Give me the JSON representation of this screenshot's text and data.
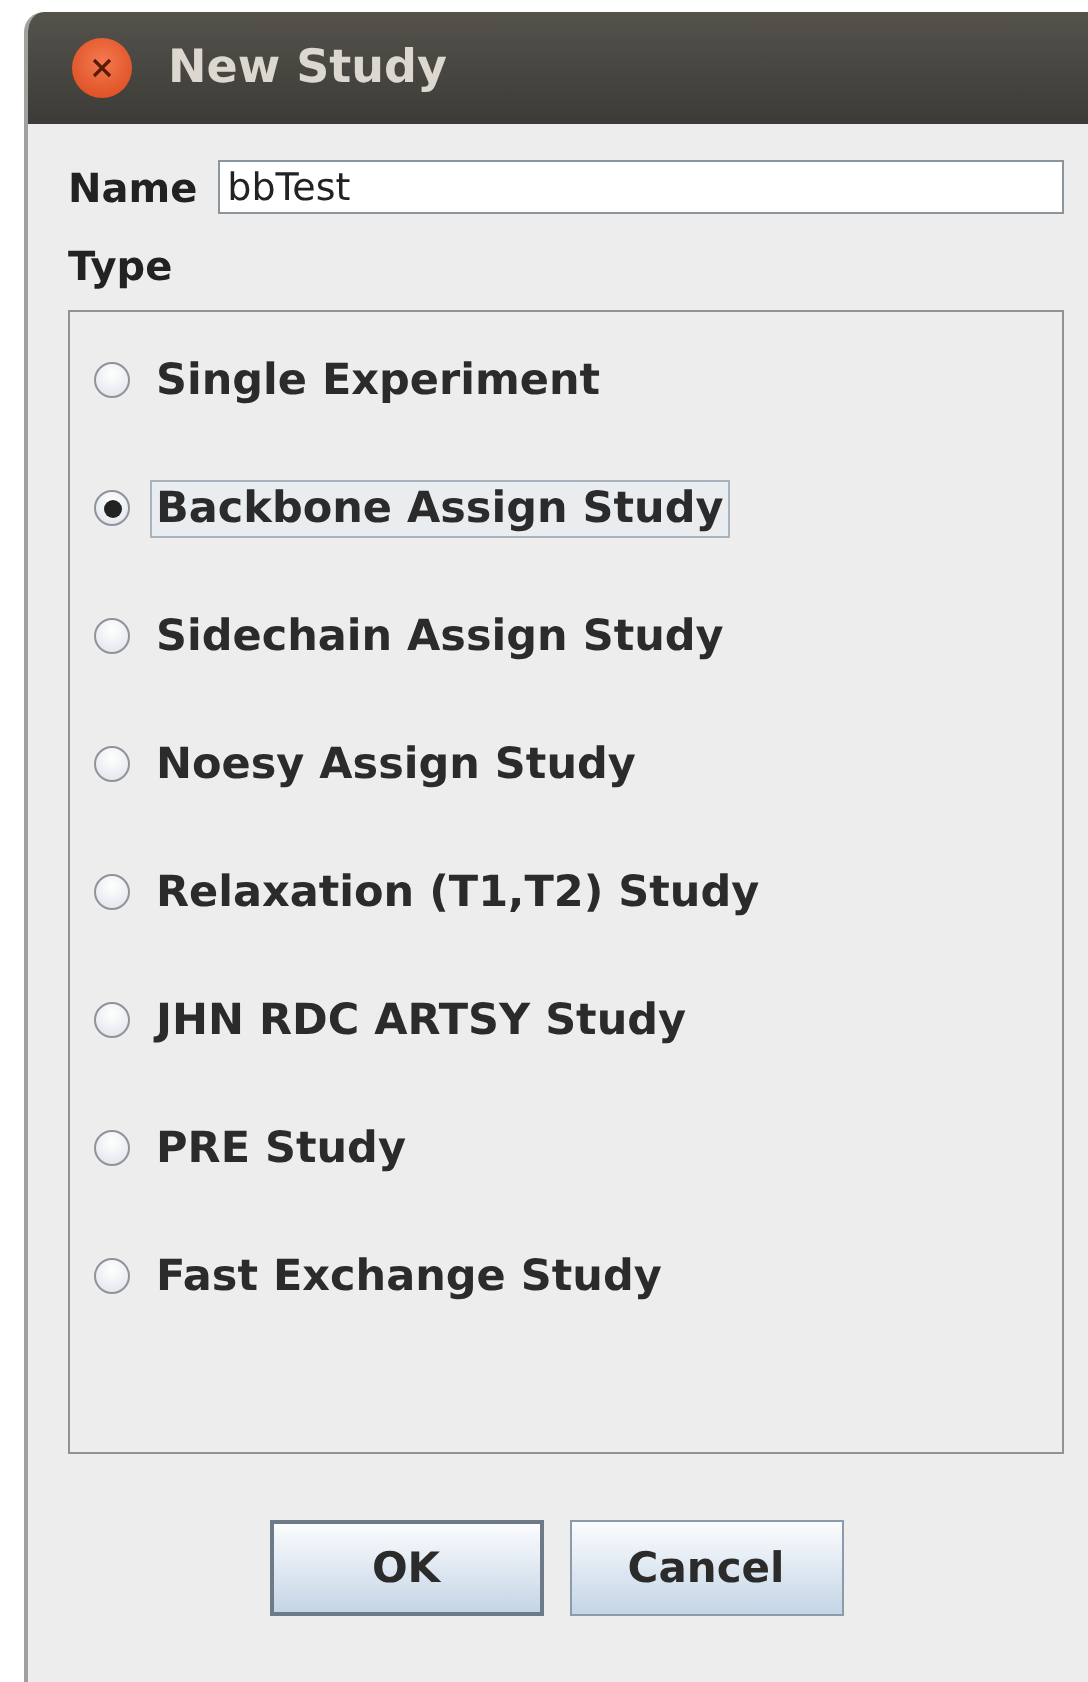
{
  "window": {
    "title": "New Study"
  },
  "name_field": {
    "label": "Name",
    "value": "bbTest"
  },
  "type_group": {
    "label": "Type",
    "options": [
      {
        "label": "Single Experiment",
        "selected": false
      },
      {
        "label": "Backbone Assign Study",
        "selected": true
      },
      {
        "label": "Sidechain Assign Study",
        "selected": false
      },
      {
        "label": "Noesy Assign Study",
        "selected": false
      },
      {
        "label": "Relaxation (T1,T2) Study",
        "selected": false
      },
      {
        "label": "JHN RDC ARTSY Study",
        "selected": false
      },
      {
        "label": "PRE Study",
        "selected": false
      },
      {
        "label": "Fast Exchange Study",
        "selected": false
      }
    ]
  },
  "buttons": [
    {
      "label": "OK",
      "default": true
    },
    {
      "label": "Cancel",
      "default": false
    }
  ]
}
